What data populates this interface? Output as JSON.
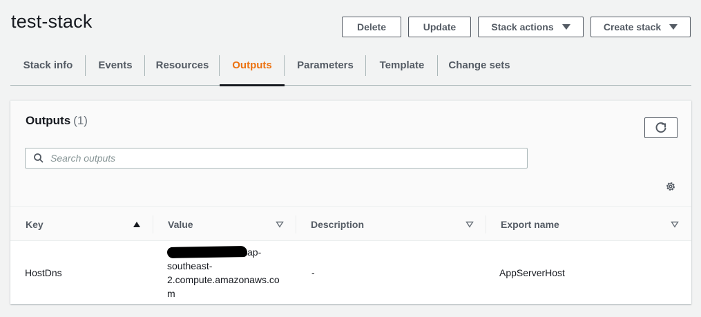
{
  "header": {
    "title": "test-stack",
    "actions": {
      "delete": "Delete",
      "update": "Update",
      "stack_actions": "Stack actions",
      "create_stack": "Create stack"
    }
  },
  "tabs": [
    {
      "label": "Stack info"
    },
    {
      "label": "Events"
    },
    {
      "label": "Resources"
    },
    {
      "label": "Outputs",
      "active": true
    },
    {
      "label": "Parameters"
    },
    {
      "label": "Template"
    },
    {
      "label": "Change sets"
    }
  ],
  "outputs": {
    "title": "Outputs",
    "count": "(1)",
    "search_placeholder": "Search outputs",
    "columns": {
      "key": "Key",
      "value": "Value",
      "description": "Description",
      "export_name": "Export name"
    },
    "rows": [
      {
        "key": "HostDns",
        "value_visible": "ap-southeast-2.compute.amazonaws.com",
        "value_line1": "ap-",
        "value_line2": "southeast-",
        "value_line3": "2.compute.amazonaws.co",
        "value_line4": "m",
        "description": "-",
        "export_name": "AppServerHost"
      }
    ]
  },
  "colors": {
    "accent": "#ec7211",
    "text": "#16191f",
    "muted": "#545b64",
    "background": "#f2f3f3"
  },
  "icons": [
    "search-icon",
    "refresh-icon",
    "gear-icon",
    "caret-down-icon",
    "sort-ascending-icon",
    "sort-icon"
  ]
}
